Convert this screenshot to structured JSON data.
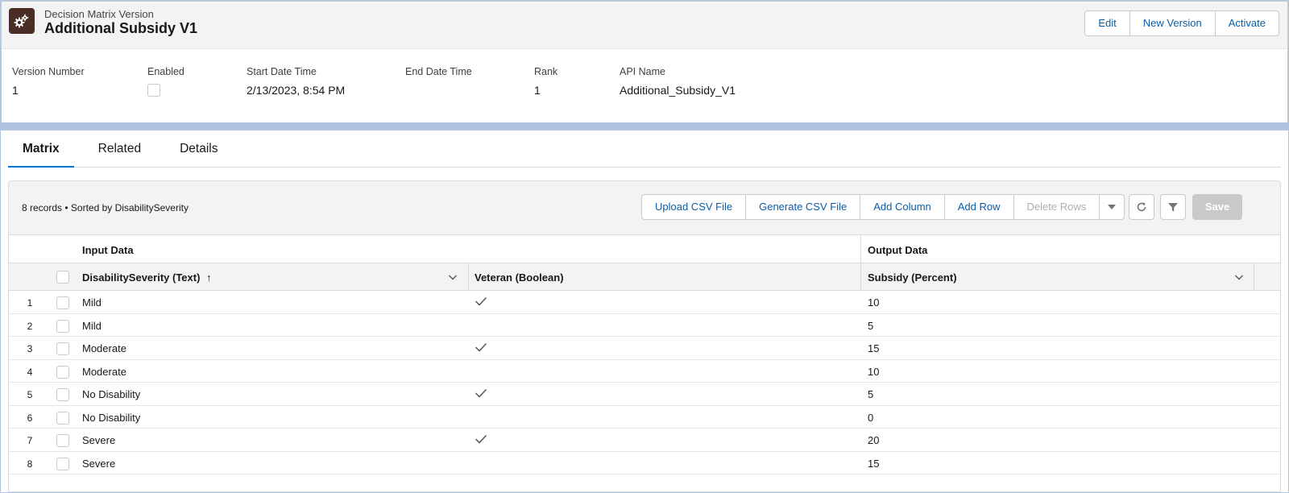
{
  "header": {
    "object_label": "Decision Matrix Version",
    "title": "Additional Subsidy V1",
    "actions": [
      "Edit",
      "New Version",
      "Activate"
    ],
    "icon": "gears-icon",
    "icon_bg": "#4a2d24"
  },
  "fields": [
    {
      "label": "Version Number",
      "value": "1"
    },
    {
      "label": "Enabled",
      "value": ""
    },
    {
      "label": "Start Date Time",
      "value": "2/13/2023, 8:54 PM"
    },
    {
      "label": "End Date Time",
      "value": ""
    },
    {
      "label": "Rank",
      "value": "1"
    },
    {
      "label": "API Name",
      "value": "Additional_Subsidy_V1"
    }
  ],
  "enabled_checked": false,
  "tabs": [
    "Matrix",
    "Related",
    "Details"
  ],
  "active_tab": "Matrix",
  "matrix": {
    "record_info": "8 records • Sorted by DisabilitySeverity",
    "toolbar": {
      "upload": "Upload CSV File",
      "generate": "Generate CSV File",
      "add_column": "Add Column",
      "add_row": "Add Row",
      "delete_rows": "Delete Rows",
      "save": "Save"
    },
    "groups": {
      "input": "Input Data",
      "output": "Output Data"
    },
    "columns": {
      "c1": "DisabilitySeverity (Text)",
      "c2": "Veteran (Boolean)",
      "c3": "Subsidy (Percent)"
    },
    "sort_indicator": "↑",
    "rows": [
      {
        "n": "1",
        "severity": "Mild",
        "veteran": true,
        "subsidy": "10"
      },
      {
        "n": "2",
        "severity": "Mild",
        "veteran": false,
        "subsidy": "5"
      },
      {
        "n": "3",
        "severity": "Moderate",
        "veteran": true,
        "subsidy": "15"
      },
      {
        "n": "4",
        "severity": "Moderate",
        "veteran": false,
        "subsidy": "10"
      },
      {
        "n": "5",
        "severity": "No Disability",
        "veteran": true,
        "subsidy": "5"
      },
      {
        "n": "6",
        "severity": "No Disability",
        "veteran": false,
        "subsidy": "0"
      },
      {
        "n": "7",
        "severity": "Severe",
        "veteran": true,
        "subsidy": "20"
      },
      {
        "n": "8",
        "severity": "Severe",
        "veteran": false,
        "subsidy": "15"
      }
    ]
  },
  "colors": {
    "brand_blue": "#0176d3",
    "link_blue": "#0b5cab",
    "disabled": "#aeaeae"
  }
}
